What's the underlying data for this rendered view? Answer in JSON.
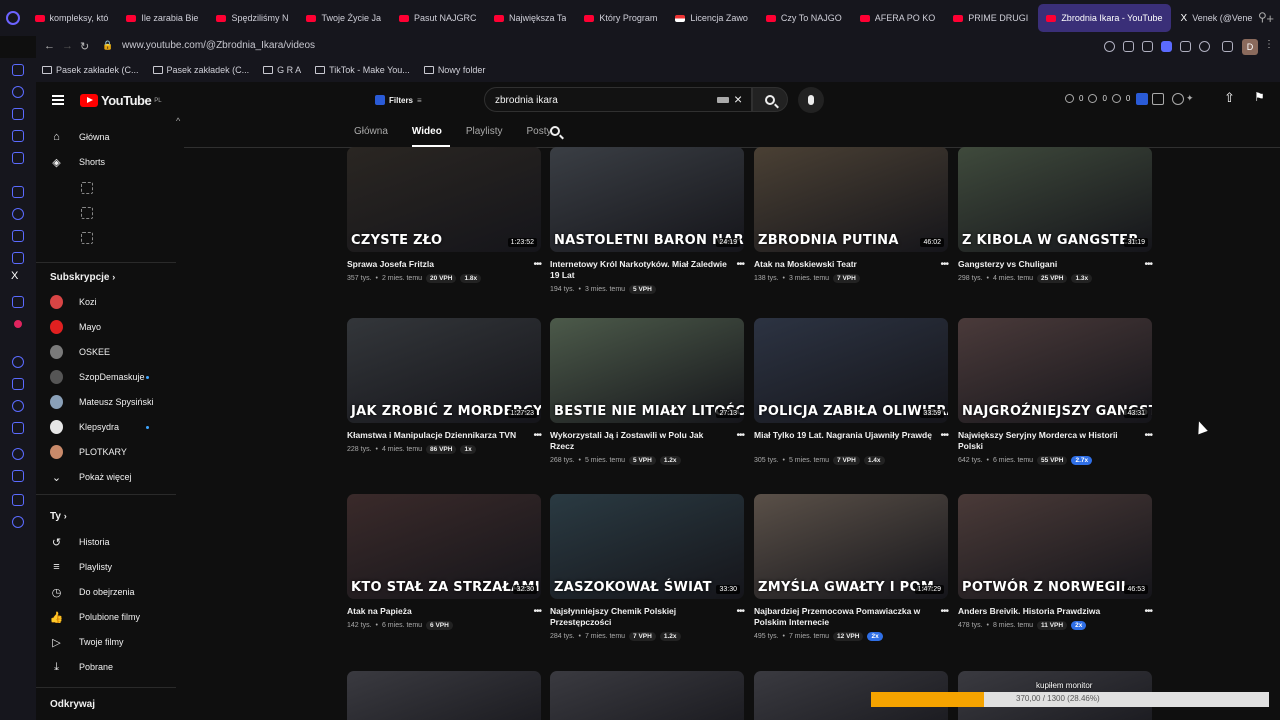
{
  "browser": {
    "tabs": [
      {
        "label": "kompleksy, któ",
        "active": false,
        "icon": "youtube-icon"
      },
      {
        "label": "Ile zarabia Bie",
        "active": false,
        "icon": "youtube-icon"
      },
      {
        "label": "Spędziliśmy N",
        "active": false,
        "icon": "youtube-icon"
      },
      {
        "label": "Twoje Życie Ja",
        "active": false,
        "icon": "youtube-icon"
      },
      {
        "label": "Pasut NAJGRC",
        "active": false,
        "icon": "youtube-icon"
      },
      {
        "label": "Największa Ta",
        "active": false,
        "icon": "youtube-icon"
      },
      {
        "label": "Który Program",
        "active": false,
        "icon": "youtube-icon"
      },
      {
        "label": "Licencja Zawo",
        "active": false,
        "icon": "flag-icon"
      },
      {
        "label": "Czy To NAJGO",
        "active": false,
        "icon": "youtube-icon"
      },
      {
        "label": "AFERA PO KO",
        "active": false,
        "icon": "youtube-icon"
      },
      {
        "label": "PRIME DRUGI",
        "active": false,
        "icon": "youtube-icon"
      },
      {
        "label": "Zbrodnia Ikara - YouTube",
        "active": true,
        "icon": "youtube-icon"
      },
      {
        "label": "Venek (@Vene",
        "active": false,
        "icon": "x-icon"
      }
    ],
    "new_tab": "+",
    "url": "www.youtube.com/@Zbrodnia_Ikara/videos",
    "profile_initial": "D",
    "bookmarks": [
      "Pasek zakładek (C...",
      "Pasek zakładek (C...",
      "G R A",
      "TikTok - Make You...",
      "Nowy folder"
    ]
  },
  "youtube": {
    "logo_text": "YouTube",
    "logo_region": "PL",
    "filters_label": "Filters",
    "search_value": "zbrodnia ikara",
    "header_stats": [
      "0",
      "0",
      "0"
    ],
    "sidebar": {
      "main": [
        {
          "label": "Główna",
          "icon": "home-icon"
        },
        {
          "label": "Shorts",
          "icon": "shorts-icon"
        }
      ],
      "subscriptions_title": "Subskrypcje",
      "subscriptions": [
        {
          "label": "Kozi",
          "color": "#d84545",
          "live": false
        },
        {
          "label": "Mayo",
          "color": "#e02020",
          "live": false
        },
        {
          "label": "OSKEE",
          "color": "#7a7a7a",
          "live": false
        },
        {
          "label": "SzopDemaskuje",
          "color": "#555555",
          "live": true
        },
        {
          "label": "Mateusz Spysiński",
          "color": "#8aa0b8",
          "live": false
        },
        {
          "label": "Klepsydra",
          "color": "#e6e6e6",
          "live": true
        },
        {
          "label": "PLOTKARY",
          "color": "#c98a6a",
          "live": false
        }
      ],
      "show_more": "Pokaż więcej",
      "you_title": "Ty",
      "you_items": [
        {
          "label": "Historia",
          "icon": "history-icon"
        },
        {
          "label": "Playlisty",
          "icon": "playlists-icon"
        },
        {
          "label": "Do obejrzenia",
          "icon": "watch-later-icon"
        },
        {
          "label": "Polubione filmy",
          "icon": "like-icon"
        },
        {
          "label": "Twoje filmy",
          "icon": "your-videos-icon"
        },
        {
          "label": "Pobrane",
          "icon": "download-icon"
        }
      ],
      "explore_title": "Odkrywaj"
    },
    "channel_tabs": [
      "Główna",
      "Wideo",
      "Playlisty",
      "Posty"
    ],
    "active_channel_tab": "Wideo",
    "videos": [
      {
        "title": "Sprawa Josefa Fritzla",
        "views": "357 tys.",
        "age": "2 mies. temu",
        "vph": "20 VPH",
        "mult": "1.8x",
        "hot": false,
        "duration": "1:23:52",
        "thumb_text": "CZYSTE ZŁO",
        "thumb_bg": "#2a2622"
      },
      {
        "title": "Internetowy Król Narkotyków. Miał Zaledwie 19 Lat",
        "views": "194 tys.",
        "age": "3 mies. temu",
        "vph": "5 VPH",
        "mult": "",
        "hot": false,
        "duration": "24:19",
        "thumb_text": "NASTOLETNI BARON NARKOTYK",
        "thumb_bg": "#3a3e44"
      },
      {
        "title": "Atak na Moskiewski Teatr",
        "views": "138 tys.",
        "age": "3 mies. temu",
        "vph": "7 VPH",
        "mult": "",
        "hot": false,
        "duration": "46:02",
        "thumb_text": "ZBRODNIA PUTINA",
        "thumb_bg": "#4a4034"
      },
      {
        "title": "Gangsterzy vs Chuligani",
        "views": "298 tys.",
        "age": "4 mies. temu",
        "vph": "25 VPH",
        "mult": "1.3x",
        "hot": false,
        "duration": "31:19",
        "thumb_text": "Z KIBOLA W GANGSTER",
        "thumb_bg": "#3f4a3c"
      },
      {
        "title": "Kłamstwa i Manipulacje Dziennikarza TVN",
        "views": "228 tys.",
        "age": "4 mies. temu",
        "vph": "86 VPH",
        "mult": "1x",
        "hot": false,
        "duration": "1:27:23",
        "thumb_text": "JAK ZROBIĆ Z MORDERCY OF",
        "thumb_bg": "#33363a"
      },
      {
        "title": "Wykorzystali Ją i Zostawili w Polu Jak Rzecz",
        "views": "268 tys.",
        "age": "5 mies. temu",
        "vph": "5 VPH",
        "mult": "1.2x",
        "hot": false,
        "duration": "27:13",
        "thumb_text": "BESTIE NIE MIAŁY LITOŚCI",
        "thumb_bg": "#4c5a4a"
      },
      {
        "title": "Miał Tylko 19 Lat. Nagrania Ujawniły Prawdę",
        "views": "305 tys.",
        "age": "5 mies. temu",
        "vph": "7 VPH",
        "mult": "1.4x",
        "hot": false,
        "duration": "33:59",
        "thumb_text": "POLICJA ZABIŁA OLIWIERA",
        "thumb_bg": "#2c3342"
      },
      {
        "title": "Największy Seryjny Morderca w Historii Polski",
        "views": "642 tys.",
        "age": "6 mies. temu",
        "vph": "55 VPH",
        "mult": "2.7x",
        "hot": true,
        "duration": "43:31",
        "thumb_text": "NAJGROŹNIEJSZY GANGSTER",
        "thumb_bg": "#4a3a3a"
      },
      {
        "title": "Atak na Papieża",
        "views": "142 tys.",
        "age": "6 mies. temu",
        "vph": "6 VPH",
        "mult": "",
        "hot": false,
        "duration": "32:30",
        "thumb_text": "KTO STAŁ ZA STRZAŁAMI",
        "thumb_bg": "#3a2a2a"
      },
      {
        "title": "Najsłynniejszy Chemik Polskiej Przestępczości",
        "views": "284 tys.",
        "age": "7 mies. temu",
        "vph": "7 VPH",
        "mult": "1.2x",
        "hot": false,
        "duration": "33:30",
        "thumb_text": "ZASZOKOWAŁ ŚWIAT",
        "thumb_bg": "#2a3a42"
      },
      {
        "title": "Najbardziej Przemocowa Pomawiaczka w Polskim Internecie",
        "views": "495 tys.",
        "age": "7 mies. temu",
        "vph": "12 VPH",
        "mult": "2x",
        "hot": true,
        "duration": "1:47:29",
        "thumb_text": "ZMYŚLA GWAŁTY I POM",
        "thumb_bg": "#5a5048"
      },
      {
        "title": "Anders Breivik. Historia Prawdziwa",
        "views": "478 tys.",
        "age": "8 mies. temu",
        "vph": "11 VPH",
        "mult": "2x",
        "hot": true,
        "duration": "46:53",
        "thumb_text": "POTWÓR Z NORWEGII",
        "thumb_bg": "#4a3a38"
      }
    ]
  },
  "overlay": {
    "monitor_label": "kupiłem monitor",
    "monitor_count": "370,00 / 1300 (28.46%)",
    "monitor_fraction": 0.2846
  },
  "colors": {
    "accent": "#ff0000",
    "hot_badge": "#2f6fe6",
    "tab_active": "#3a2f78"
  }
}
